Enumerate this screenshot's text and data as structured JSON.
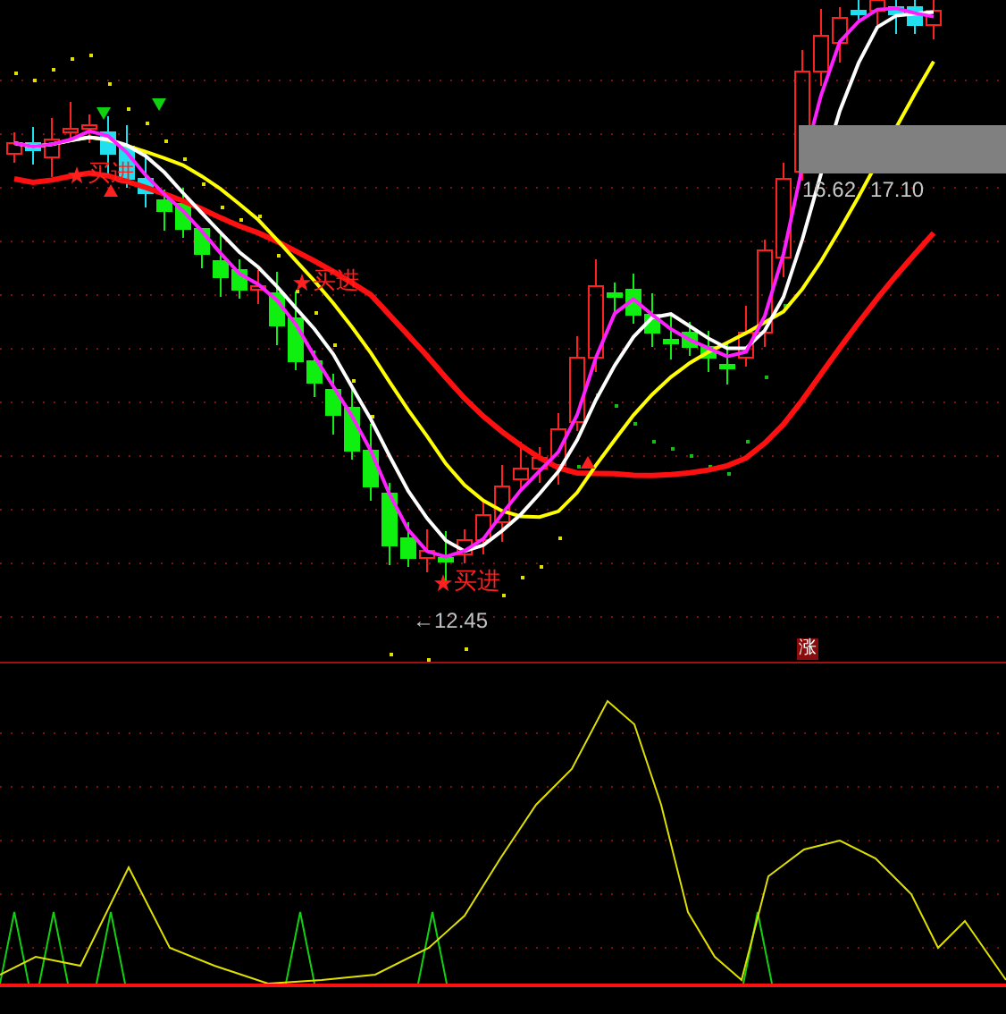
{
  "signals": [
    {
      "label": "买进"
    },
    {
      "label": "买进"
    },
    {
      "label": "买进"
    }
  ],
  "low_marker": {
    "label": "←12.45"
  },
  "price_readout": {
    "values": [
      "16.62",
      "17.10"
    ]
  },
  "limit_badge": {
    "label": "涨"
  }
}
